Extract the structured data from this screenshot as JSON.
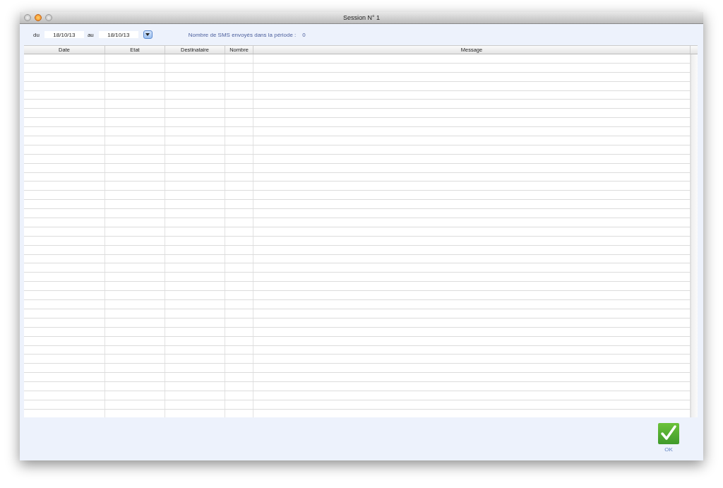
{
  "window": {
    "title": "Session N° 1"
  },
  "filter": {
    "from_label": "du",
    "from_value": "18/10/13",
    "to_label": "au",
    "to_value": "18/10/13",
    "count_label": "Nombre de SMS envoyés dans la période :",
    "count_value": "0"
  },
  "table": {
    "columns": [
      "Date",
      "Etat",
      "Destinataire",
      "Nombre",
      "Message"
    ]
  },
  "ok_button": {
    "label": "OK"
  }
}
